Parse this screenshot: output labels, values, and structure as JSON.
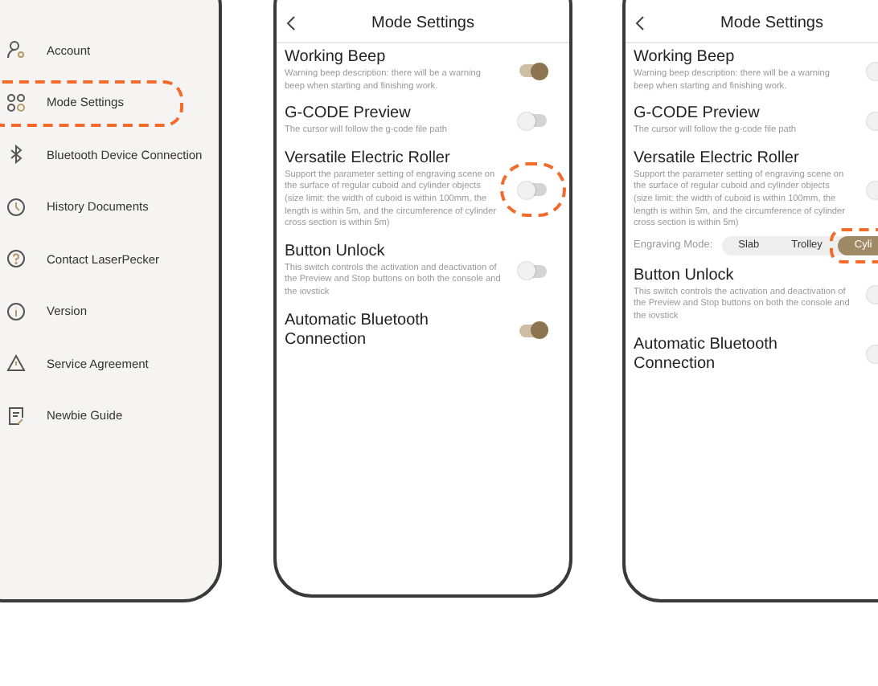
{
  "screens": [
    {
      "kind": "menu",
      "items": [
        {
          "label": "Account",
          "highlighted": false
        },
        {
          "label": "Mode Settings",
          "highlighted": true
        },
        {
          "label": "Bluetooth Device Connection",
          "highlighted": false
        },
        {
          "label": "History Documents",
          "highlighted": false
        },
        {
          "label": "Contact LaserPecker",
          "highlighted": false
        },
        {
          "label": "Version",
          "highlighted": false
        },
        {
          "label": "Service Agreement",
          "highlighted": false
        },
        {
          "label": "Newbie Guide",
          "highlighted": false
        }
      ]
    },
    {
      "kind": "settings",
      "title": "Mode Settings",
      "items": [
        {
          "title": "Working Beep",
          "description": "Warning beep description: there will be a warning beep when starting and finishing work.",
          "on": true,
          "highlighted": false
        },
        {
          "title": "G-CODE Preview",
          "description": "The cursor will follow the g-code file path",
          "on": false,
          "highlighted": false
        },
        {
          "title": "Versatile Electric Roller",
          "description": "Support the parameter setting of engraving scene on the surface of regular cuboid and cylinder objects (size limit: the width of cuboid is within 100mm, the length is within 5m, and the circumference of cylinder cross section is within 5m)",
          "on": false,
          "highlighted": true
        },
        {
          "title": "Button Unlock",
          "description": "This switch controls the activation and deactivation of the Preview and Stop buttons on both the console and the iovstick",
          "on": false,
          "highlighted": false
        },
        {
          "title": "Automatic Bluetooth Connection",
          "on": true,
          "highlighted": false
        }
      ]
    },
    {
      "kind": "settings",
      "title": "Mode Settings",
      "items": [
        {
          "title": "Working Beep",
          "description": "Warning beep description: there will be a warning beep when starting and finishing work.",
          "on": false,
          "highlighted": false
        },
        {
          "title": "G-CODE Preview",
          "description": "The cursor will follow the g-code file path",
          "on": false,
          "highlighted": false
        },
        {
          "title": "Versatile Electric Roller",
          "description": "Support the parameter setting of engraving scene on the surface of regular cuboid and cylinder objects (size limit: the width of cuboid is within 100mm, the length is within 5m, and the circumference of cylinder cross section is within 5m)",
          "on": false,
          "highlighted": false,
          "engraving_mode": {
            "label": "Engraving Mode:",
            "options": [
              {
                "label": "Slab",
                "selected": false,
                "highlighted": false
              },
              {
                "label": "Trolley",
                "selected": false,
                "highlighted": false
              },
              {
                "label": "Cyli",
                "selected": true,
                "highlighted": true
              }
            ]
          }
        },
        {
          "title": "Button Unlock",
          "description": "This switch controls the activation and deactivation of the Preview and Stop buttons on both the console and the iovstick",
          "on": false,
          "highlighted": false
        },
        {
          "title": "Automatic Bluetooth Connection",
          "on": false,
          "highlighted": false
        }
      ]
    }
  ]
}
